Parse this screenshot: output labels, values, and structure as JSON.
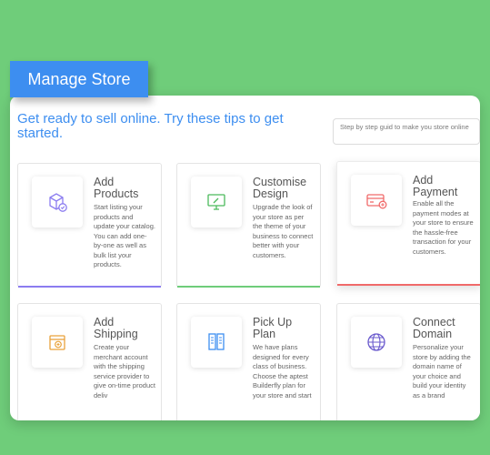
{
  "badge": {
    "label": "Manage Store"
  },
  "headline": "Get ready to sell online. Try these tips to get started.",
  "search": {
    "text": "Step by step guid to make you store online"
  },
  "cards": [
    {
      "title": "Add Products",
      "desc": "Start listing your products and update your catalog. You can add one-by-one as well as bulk list your products.",
      "icon": "products-box-icon",
      "accent": "#8b7cf0"
    },
    {
      "title": "Customise Design",
      "desc": "Upgrade the look of your store as per the theme of your business to connect better with your customers.",
      "icon": "design-monitor-icon",
      "accent": "#6fcd7a"
    },
    {
      "title": "Add Payment",
      "desc": "Enable all the payment modes at your store to ensure the hassle-free transaction for your customers.",
      "icon": "payment-card-icon",
      "accent": "#f06a6a"
    },
    {
      "title": "Add Shipping",
      "desc": "Create your merchant account with the shipping service provider to give on-time product deliv",
      "icon": "shipping-box-icon"
    },
    {
      "title": "Pick Up Plan",
      "desc": "We have plans designed for every class of business. Choose the aptest Builderfly plan for your store and start",
      "icon": "plan-document-icon"
    },
    {
      "title": "Connect Domain",
      "desc": "Personalize your store by adding the domain name of your choice and build your identity as a brand",
      "icon": "domain-globe-icon"
    }
  ]
}
